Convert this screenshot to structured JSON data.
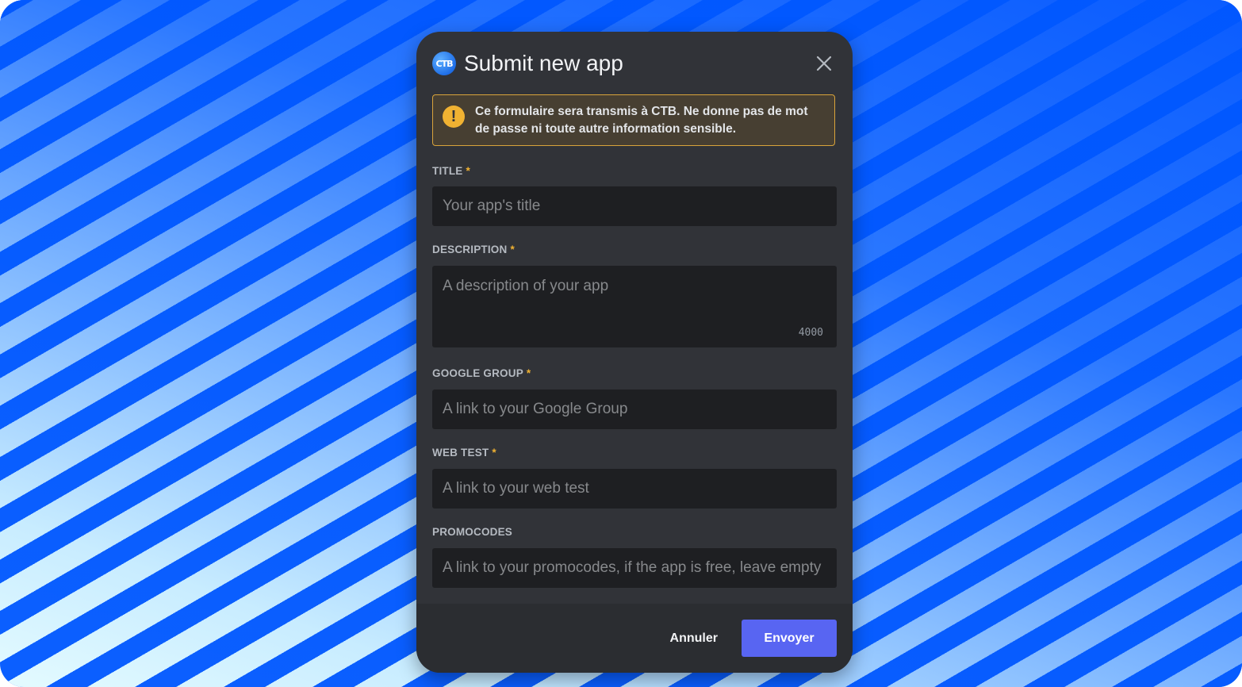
{
  "modal": {
    "logo_text": "CTB",
    "title": "Submit new app"
  },
  "warning": {
    "text": "Ce formulaire sera transmis à CTB. Ne donne pas de mot de passe ni toute autre information sensible.",
    "icon_glyph": "!"
  },
  "fields": [
    {
      "label": "TITLE",
      "required": "*",
      "placeholder": "Your app's title"
    },
    {
      "label": "DESCRIPTION",
      "required": "*",
      "placeholder": "A description of your app",
      "char_limit": "4000"
    },
    {
      "label": "GOOGLE GROUP",
      "required": "*",
      "placeholder": "A link to your Google Group"
    },
    {
      "label": "WEB TEST",
      "required": "*",
      "placeholder": "A link to your web test"
    },
    {
      "label": "PROMOCODES",
      "required": "",
      "placeholder": "A link to your promocodes, if the app is free, leave empty"
    }
  ],
  "footer": {
    "cancel_label": "Annuler",
    "submit_label": "Envoyer"
  },
  "colors": {
    "background_blue": "#0055ff",
    "modal_bg": "#313338",
    "input_bg": "#1e1f22",
    "warning_border": "#d9a43b",
    "warning_icon": "#f0b232",
    "submit_bg": "#5865f2"
  }
}
